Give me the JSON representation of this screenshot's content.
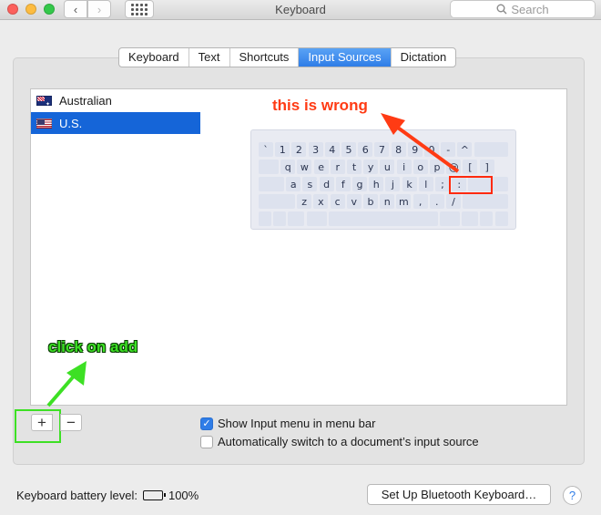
{
  "window": {
    "title": "Keyboard"
  },
  "search": {
    "placeholder": "Search",
    "icon": "search-icon"
  },
  "tabs": [
    {
      "label": "Keyboard",
      "active": false
    },
    {
      "label": "Text",
      "active": false
    },
    {
      "label": "Shortcuts",
      "active": false
    },
    {
      "label": "Input Sources",
      "active": true
    },
    {
      "label": "Dictation",
      "active": false
    }
  ],
  "sources": [
    {
      "label": "Australian",
      "flag": "australia-flag",
      "selected": false
    },
    {
      "label": "U.S.",
      "flag": "us-flag",
      "selected": true
    }
  ],
  "keyboard": {
    "rows": [
      [
        "`",
        "1",
        "2",
        "3",
        "4",
        "5",
        "6",
        "7",
        "8",
        "9",
        "0",
        "-",
        "^",
        ""
      ],
      [
        "",
        "q",
        "w",
        "e",
        "r",
        "t",
        "y",
        "u",
        "i",
        "o",
        "p",
        "@",
        "[",
        "]"
      ],
      [
        "",
        "a",
        "s",
        "d",
        "f",
        "g",
        "h",
        "j",
        "k",
        "l",
        ";",
        ":",
        ""
      ],
      [
        "",
        "z",
        "x",
        "c",
        "v",
        "b",
        "n",
        "m",
        ",",
        ".",
        "/",
        ""
      ]
    ]
  },
  "annotations": {
    "wrong": "this is wrong",
    "add": "click on add",
    "accent_red": "#ff3b14",
    "accent_green": "#3de024"
  },
  "buttons": {
    "add": "+",
    "remove": "−"
  },
  "options": {
    "show_menu": {
      "label": "Show Input menu in menu bar",
      "checked": true
    },
    "auto_switch": {
      "label": "Automatically switch to a document’s input source",
      "checked": false
    }
  },
  "footer": {
    "battery_label": "Keyboard battery level:",
    "battery_value": "100%",
    "bluetooth_button": "Set Up Bluetooth Keyboard…",
    "help": "?"
  }
}
